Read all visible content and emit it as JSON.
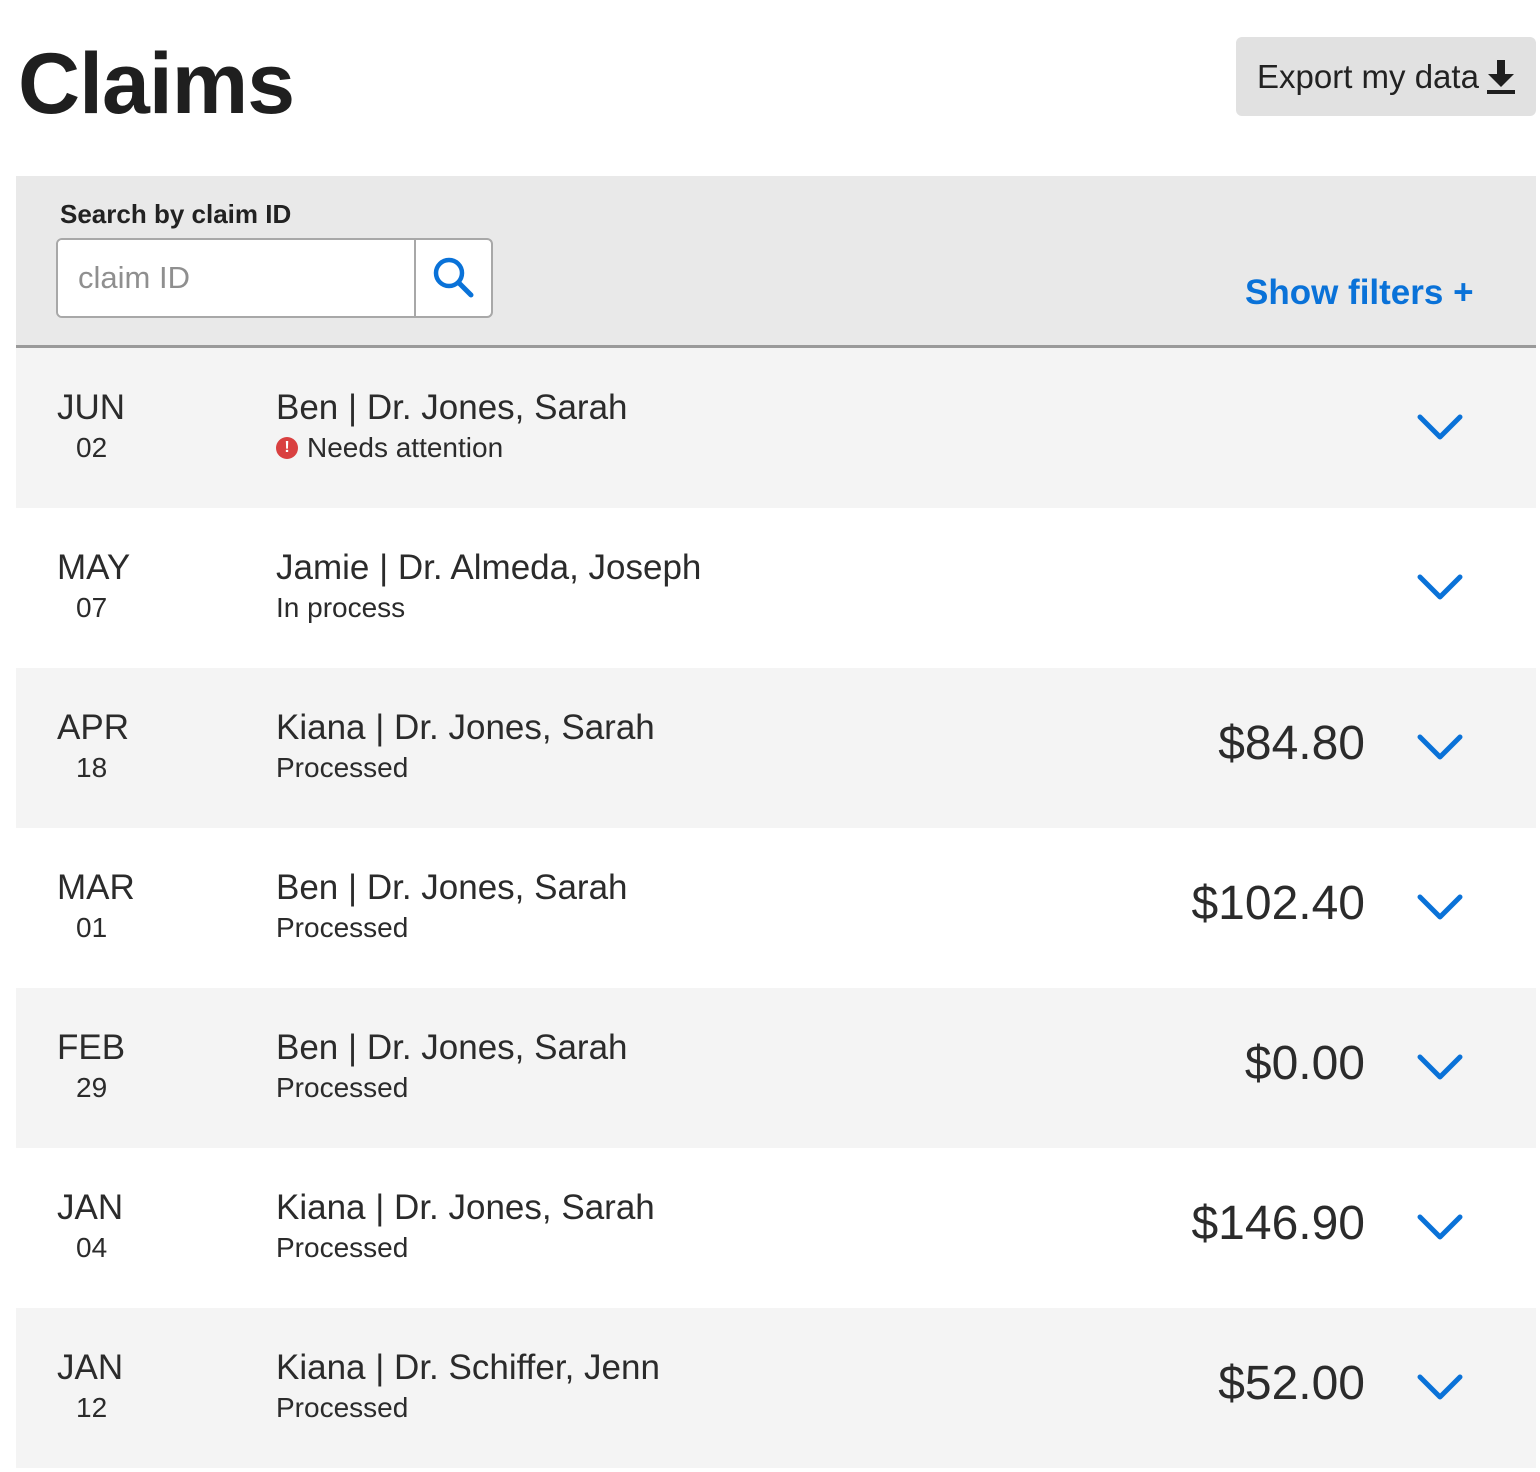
{
  "header": {
    "title": "Claims",
    "export_label": "Export my data",
    "export_icon": "download-icon"
  },
  "search": {
    "label": "Search by claim ID",
    "placeholder": "claim ID",
    "value": "",
    "button_icon": "search-icon",
    "show_filters_label": "Show filters +"
  },
  "colors": {
    "accent": "#0a72d8",
    "alert": "#d94040",
    "row_alt": "#f4f4f4",
    "panel": "#e9e9e9"
  },
  "claims": [
    {
      "month": "JUN",
      "day": "02",
      "title": "Ben | Dr. Jones, Sarah",
      "status": "Needs attention",
      "alert": true,
      "amount": ""
    },
    {
      "month": "MAY",
      "day": "07",
      "title": "Jamie | Dr. Almeda, Joseph",
      "status": "In process",
      "alert": false,
      "amount": ""
    },
    {
      "month": "APR",
      "day": "18",
      "title": "Kiana | Dr. Jones, Sarah",
      "status": "Processed",
      "alert": false,
      "amount": "$84.80"
    },
    {
      "month": "MAR",
      "day": "01",
      "title": "Ben | Dr. Jones, Sarah",
      "status": "Processed",
      "alert": false,
      "amount": "$102.40"
    },
    {
      "month": "FEB",
      "day": "29",
      "title": "Ben | Dr. Jones, Sarah",
      "status": "Processed",
      "alert": false,
      "amount": "$0.00"
    },
    {
      "month": "JAN",
      "day": "04",
      "title": "Kiana | Dr. Jones, Sarah",
      "status": "Processed",
      "alert": false,
      "amount": "$146.90"
    },
    {
      "month": "JAN",
      "day": "12",
      "title": "Kiana | Dr. Schiffer, Jenn",
      "status": "Processed",
      "alert": false,
      "amount": "$52.00"
    }
  ]
}
